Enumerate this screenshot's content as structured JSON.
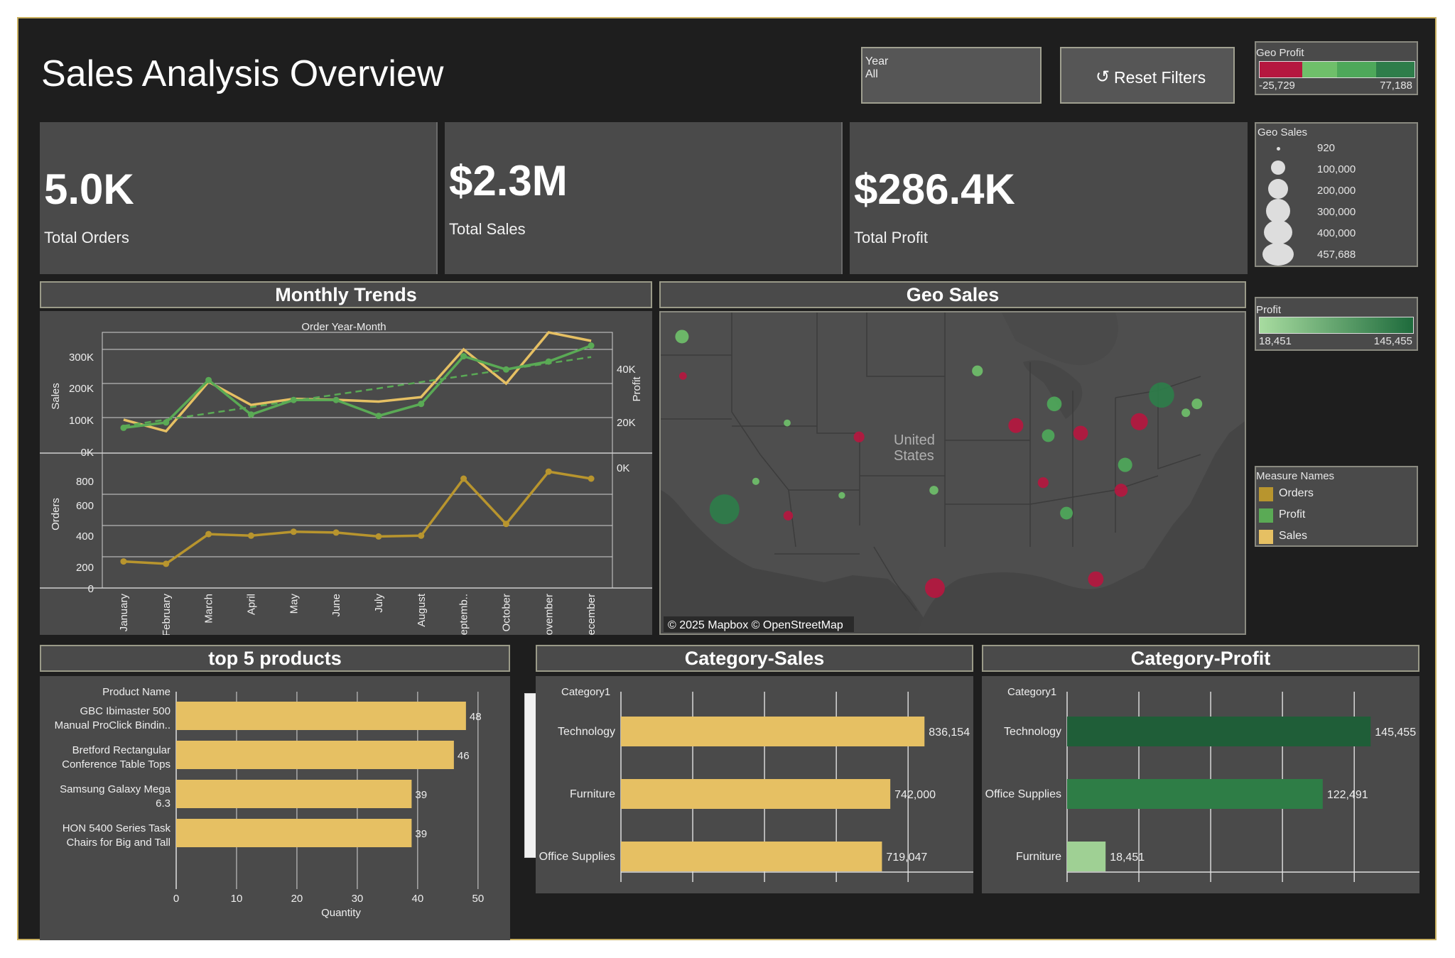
{
  "title": "Sales Analysis Overview",
  "filter": {
    "label": "Year",
    "value": "All"
  },
  "reset_button": {
    "icon": "reset-icon",
    "label": "Reset Filters"
  },
  "geo_profit_legend": {
    "title": "Geo Profit",
    "min": "-25,729",
    "max": "77,188",
    "colors": [
      "#b5173f",
      "#6fbf6a",
      "#4ea85a",
      "#2e7d4a"
    ]
  },
  "geo_sales_legend": {
    "title": "Geo Sales",
    "sizes": [
      "920",
      "100,000",
      "200,000",
      "300,000",
      "400,000",
      "457,688"
    ]
  },
  "profit_legend": {
    "title": "Profit",
    "min": "18,451",
    "max": "145,455",
    "colors": [
      "#a8dca0",
      "#1e6b3c"
    ]
  },
  "measure_legend": {
    "title": "Measure Names",
    "items": [
      {
        "label": "Orders",
        "color": "#b8952e"
      },
      {
        "label": "Profit",
        "color": "#5aaa55"
      },
      {
        "label": "Sales",
        "color": "#e6c063"
      }
    ]
  },
  "kpis": [
    {
      "value": "5.0K",
      "label": "Total Orders"
    },
    {
      "value": "$2.3M",
      "label": "Total Sales"
    },
    {
      "value": "$286.4K",
      "label": "Total Profit"
    }
  ],
  "monthly_trends": {
    "header": "Monthly Trends",
    "col_title": "Order Year-Month",
    "sales_axis_label": "Sales",
    "profit_axis_label": "Profit",
    "orders_axis_label": "Orders",
    "sales_ticks": [
      "300K",
      "200K",
      "100K",
      "0K"
    ],
    "profit_ticks": [
      "40K",
      "20K",
      "0K"
    ],
    "orders_ticks": [
      "800",
      "600",
      "400",
      "200",
      "0"
    ]
  },
  "geo_sales": {
    "header": "Geo Sales",
    "country_label_1": "United",
    "country_label_2": "States",
    "attribution": "© 2025 Mapbox © OpenStreetMap"
  },
  "top_products": {
    "header": "top 5 products",
    "row_title": "Product Name",
    "x_title": "Quantity",
    "x_ticks": [
      "0",
      "10",
      "20",
      "30",
      "40",
      "50"
    ],
    "products": [
      {
        "name1": "GBC Ibimaster 500",
        "name2": "Manual ProClick Bindin..",
        "qty": 48
      },
      {
        "name1": "Bretford Rectangular",
        "name2": "Conference Table Tops",
        "qty": 46
      },
      {
        "name1": "Samsung Galaxy Mega",
        "name2": "6.3",
        "qty": 39
      },
      {
        "name1": "HON 5400 Series Task",
        "name2": "Chairs for Big and Tall",
        "qty": 39
      }
    ]
  },
  "category_sales": {
    "header": "Category-Sales",
    "axis_title": "Category1"
  },
  "category_profit": {
    "header": "Category-Profit",
    "axis_title": "Category1"
  },
  "chart_data": [
    {
      "type": "line",
      "title": "Monthly Trends",
      "x": [
        "January",
        "February",
        "March",
        "April",
        "May",
        "June",
        "July",
        "August",
        "Septemb..",
        "October",
        "November",
        "December"
      ],
      "series": [
        {
          "name": "Sales",
          "axis": "Sales",
          "values": [
            94000,
            60000,
            205000,
            137000,
            155000,
            152000,
            147000,
            160000,
            300000,
            200000,
            350000,
            325000
          ]
        },
        {
          "name": "Profit",
          "axis": "Profit",
          "values": [
            9000,
            11000,
            27000,
            14000,
            19500,
            19500,
            13500,
            18000,
            36000,
            31000,
            34000,
            40000
          ]
        },
        {
          "name": "Orders",
          "axis": "Orders",
          "values": [
            170,
            155,
            345,
            335,
            360,
            355,
            330,
            335,
            700,
            410,
            745,
            700
          ]
        }
      ],
      "ylim_sales": [
        0,
        350000
      ],
      "ylim_profit": [
        0,
        45000
      ],
      "ylim_orders": [
        0,
        800
      ]
    },
    {
      "type": "scatter",
      "title": "Geo Sales",
      "points": [
        {
          "lon": -122.4,
          "lat": 47.6,
          "sales": 60000,
          "profit": 9000
        },
        {
          "lon": -122.3,
          "lat": 44.5,
          "sales": 8000,
          "profit": -3000
        },
        {
          "lon": -118.2,
          "lat": 34.0,
          "sales": 457688,
          "profit": 77188
        },
        {
          "lon": -115.1,
          "lat": 36.2,
          "sales": 6000,
          "profit": 5000
        },
        {
          "lon": -112.0,
          "lat": 40.8,
          "sales": 5000,
          "profit": 3000
        },
        {
          "lon": -111.9,
          "lat": 33.5,
          "sales": 20000,
          "profit": -10000
        },
        {
          "lon": -106.6,
          "lat": 35.1,
          "sales": 4000,
          "profit": 1000
        },
        {
          "lon": -104.9,
          "lat": 39.7,
          "sales": 30000,
          "profit": -7000
        },
        {
          "lon": -97.4,
          "lat": 27.8,
          "sales": 170000,
          "profit": -25729
        },
        {
          "lon": -97.5,
          "lat": 35.5,
          "sales": 15000,
          "profit": 3000
        },
        {
          "lon": -93.2,
          "lat": 44.9,
          "sales": 30000,
          "profit": 10000
        },
        {
          "lon": -89.4,
          "lat": 40.6,
          "sales": 80000,
          "profit": -12000
        },
        {
          "lon": -85.6,
          "lat": 42.3,
          "sales": 76000,
          "profit": 24000
        },
        {
          "lon": -86.2,
          "lat": 39.8,
          "sales": 50000,
          "profit": 18000
        },
        {
          "lon": -83.0,
          "lat": 40.0,
          "sales": 78000,
          "profit": -16000
        },
        {
          "lon": -77.2,
          "lat": 40.9,
          "sales": 116000,
          "profit": -15000
        },
        {
          "lon": -75.0,
          "lat": 43.0,
          "sales": 310000,
          "profit": 74000
        },
        {
          "lon": -78.6,
          "lat": 37.5,
          "sales": 70000,
          "profit": 18000
        },
        {
          "lon": -79.0,
          "lat": 35.5,
          "sales": 55000,
          "profit": -7000
        },
        {
          "lon": -86.7,
          "lat": 36.1,
          "sales": 30000,
          "profit": -5000
        },
        {
          "lon": -84.4,
          "lat": 33.7,
          "sales": 50000,
          "profit": 16000
        },
        {
          "lon": -81.5,
          "lat": 28.5,
          "sales": 89000,
          "profit": -3400
        },
        {
          "lon": -71.5,
          "lat": 42.3,
          "sales": 28000,
          "profit": 7000
        },
        {
          "lon": -72.6,
          "lat": 41.6,
          "sales": 13000,
          "profit": 3500
        }
      ]
    },
    {
      "type": "bar",
      "title": "top 5 products",
      "categories": [
        "GBC Ibimaster 500 Manual ProClick Bindin..",
        "Bretford Rectangular Conference Table Tops",
        "Samsung Galaxy Mega 6.3",
        "HON 5400 Series Task Chairs for Big and Tall"
      ],
      "values": [
        48,
        46,
        39,
        39
      ],
      "xlabel": "Quantity",
      "xlim": [
        0,
        50
      ]
    },
    {
      "type": "bar",
      "title": "Category-Sales",
      "categories": [
        "Technology",
        "Furniture",
        "Office Supplies"
      ],
      "values": [
        836154,
        742000,
        719047
      ],
      "labels": [
        "836,154",
        "742,000",
        "719,047"
      ]
    },
    {
      "type": "bar",
      "title": "Category-Profit",
      "categories": [
        "Technology",
        "Office Supplies",
        "Furniture"
      ],
      "values": [
        145455,
        122491,
        18451
      ],
      "labels": [
        "145,455",
        "122,491",
        "18,451"
      ],
      "colors": [
        "#1f5e38",
        "#2e7d46",
        "#9fd094"
      ]
    }
  ]
}
